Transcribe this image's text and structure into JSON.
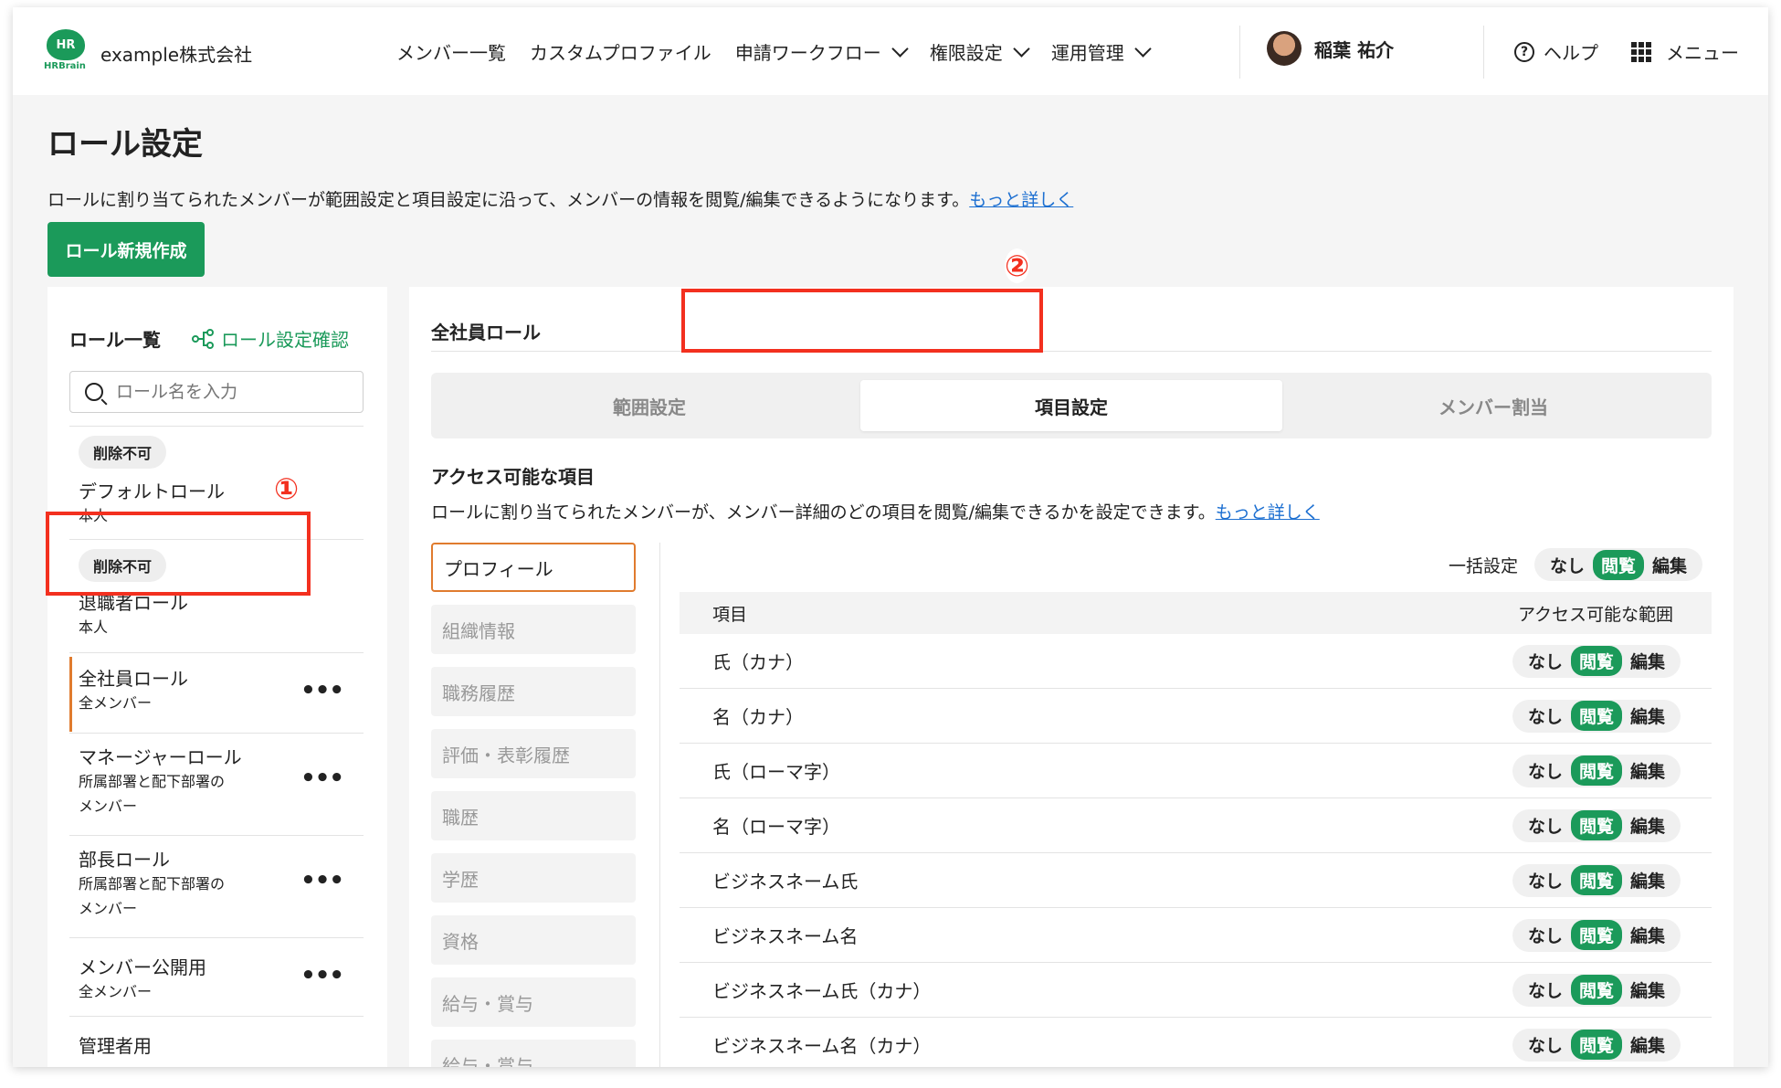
{
  "header": {
    "logo_text": "HR",
    "logo_sub": "HRBrain",
    "company": "example株式会社",
    "nav": [
      {
        "label": "メンバー一覧",
        "has_dropdown": false
      },
      {
        "label": "カスタムプロファイル",
        "has_dropdown": false
      },
      {
        "label": "申請ワークフロー",
        "has_dropdown": true
      },
      {
        "label": "権限設定",
        "has_dropdown": true
      },
      {
        "label": "運用管理",
        "has_dropdown": true
      }
    ],
    "user_name": "稲葉 祐介",
    "help_label": "ヘルプ",
    "menu_label": "メニュー"
  },
  "page": {
    "title": "ロール設定",
    "description": "ロールに割り当てられたメンバーが範囲設定と項目設定に沿って、メンバーの情報を閲覧/編集できるようになります。",
    "more_link": "もっと詳しく",
    "new_role_button": "ロール新規作成"
  },
  "role_panel": {
    "title": "ロール一覧",
    "check_link": "ロール設定確認",
    "search_placeholder": "ロール名を入力",
    "roles": [
      {
        "badge": "削除不可",
        "name": "デフォルトロール",
        "sub": "本人",
        "menu": ""
      },
      {
        "badge": "削除不可",
        "name": "退職者ロール",
        "sub": "本人",
        "menu": ""
      },
      {
        "badge": "",
        "name": "全社員ロール",
        "sub": "全メンバー",
        "menu": "•••",
        "selected": true
      },
      {
        "badge": "",
        "name": "マネージャーロール",
        "sub": "所属部署と配下部署の",
        "sub2": "メンバー",
        "menu": "•••"
      },
      {
        "badge": "",
        "name": "部長ロール",
        "sub": "所属部署と配下部署の",
        "sub2": "メンバー",
        "menu": "•••"
      },
      {
        "badge": "",
        "name": "メンバー公開用",
        "sub": "全メンバー",
        "menu": "•••"
      },
      {
        "badge": "",
        "name": "管理者用",
        "sub": "",
        "menu": ""
      }
    ]
  },
  "detail": {
    "role_title": "全社員ロール",
    "tabs": [
      "範囲設定",
      "項目設定",
      "メンバー割当"
    ],
    "active_tab": 1,
    "section_title": "アクセス可能な項目",
    "section_desc": "ロールに割り当てられたメンバーが、メンバー詳細のどの項目を閲覧/編集できるかを設定できます。",
    "section_link": "もっと詳しく",
    "categories": [
      "プロフィール",
      "組織情報",
      "職務履歴",
      "評価・表彰履歴",
      "職歴",
      "学歴",
      "資格",
      "給与・賞与",
      "給与・賞与"
    ],
    "bulk_label": "一括設定",
    "access_options": [
      "なし",
      "閲覧",
      "編集"
    ],
    "col_item": "項目",
    "col_access": "アクセス可能な範囲",
    "rows": [
      {
        "name": "氏（カナ）",
        "value": "閲覧"
      },
      {
        "name": "名（カナ）",
        "value": "閲覧"
      },
      {
        "name": "氏（ローマ字）",
        "value": "閲覧"
      },
      {
        "name": "名（ローマ字）",
        "value": "閲覧"
      },
      {
        "name": "ビジネスネーム氏",
        "value": "閲覧"
      },
      {
        "name": "ビジネスネーム名",
        "value": "閲覧"
      },
      {
        "name": "ビジネスネーム氏（カナ）",
        "value": "閲覧"
      },
      {
        "name": "ビジネスネーム名（カナ）",
        "value": "閲覧"
      }
    ]
  },
  "annotations": {
    "one": "①",
    "two": "②"
  },
  "colors": {
    "brand": "#1b9a5a",
    "highlight": "#f3301f",
    "focus": "#e07b2e",
    "link": "#1c6fd1"
  }
}
